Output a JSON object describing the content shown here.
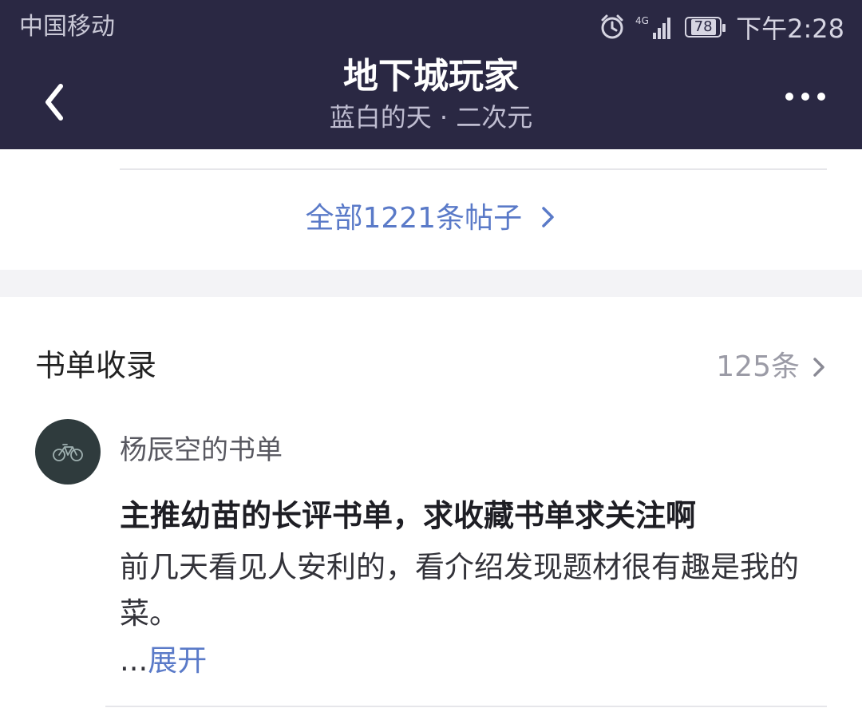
{
  "status_bar": {
    "carrier": "中国移动",
    "network": "4G",
    "battery": "78",
    "time": "下午2:28"
  },
  "header": {
    "title": "地下城玩家",
    "subtitle": "蓝白的天 · 二次元",
    "icons": {
      "back": "chevron-left-icon",
      "more": "more-dots-icon"
    }
  },
  "posts_link": {
    "label": "全部1221条帖子"
  },
  "booklist_section": {
    "title": "书单收录",
    "count": "125条",
    "item": {
      "name": "杨辰空的书单",
      "headline": "主推幼苗的长评书单，求收藏书单求关注啊",
      "description": "前几天看见人安利的，看介绍发现题材很有趣是我的菜。",
      "ellipsis": "...",
      "expand_label": "展开"
    }
  },
  "colors": {
    "header_bg": "#2a2843",
    "link": "#5a7ac8",
    "muted": "#9b9ba6"
  }
}
